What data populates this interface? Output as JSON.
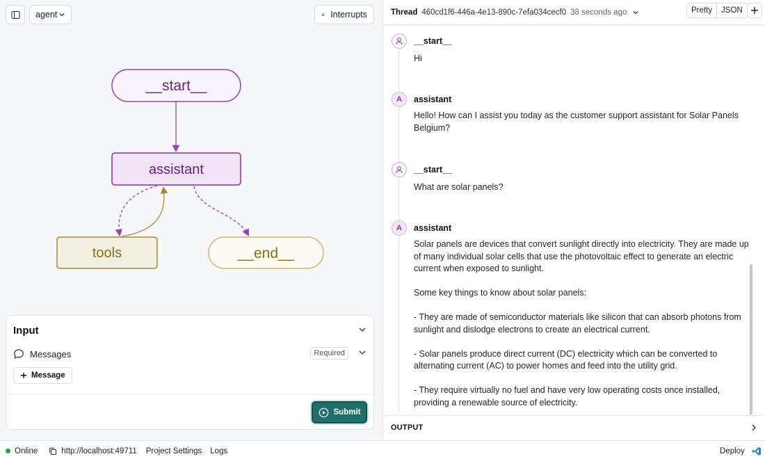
{
  "toolbar": {
    "graph_select": "agent",
    "interrupts_label": "Interrupts"
  },
  "graph": {
    "nodes": {
      "start": "__start__",
      "assistant": "assistant",
      "tools": "tools",
      "end": "__end__"
    },
    "colors": {
      "start_stroke": "#9b3fb5",
      "assistant_stroke": "#8b2fa8",
      "assistant_fill": "#f0e3f5",
      "tools_stroke": "#a78a2e",
      "tools_fill": "#f1eee2",
      "end_stroke": "#d0b86a",
      "node_text_purple": "#6b1f86",
      "node_text_gold": "#8a6d18"
    }
  },
  "input": {
    "title": "Input",
    "messages_label": "Messages",
    "required_label": "Required",
    "add_message_label": "Message",
    "submit_label": "Submit"
  },
  "thread": {
    "label": "Thread",
    "id": "460cd1f6-446a-4e13-890c-7efa034cecf0",
    "time": "38 seconds ago",
    "view_pretty": "Pretty",
    "view_json": "JSON",
    "messages": [
      {
        "avatar": "",
        "role": "__start__",
        "text": "Hi"
      },
      {
        "avatar": "A",
        "role": "assistant",
        "text": "Hello! How can I assist you today as the customer support assistant for Solar Panels Belgium?"
      },
      {
        "avatar": "",
        "role": "__start__",
        "text": "What are solar panels?"
      },
      {
        "avatar": "A",
        "role": "assistant",
        "text": "Solar panels are devices that convert sunlight directly into electricity. They are made up of many individual solar cells that use the photovoltaic effect to generate an electric current when exposed to sunlight.\n\nSome key things to know about solar panels:\n\n- They are made of semiconductor materials like silicon that can absorb photons from sunlight and dislodge electrons to create an electrical current.\n\n- Solar panels produce direct current (DC) electricity which can be converted to alternating current (AC) to power homes and feed into the utility grid.\n\n- They require virtually no fuel and have very low operating costs once installed, providing a renewable source of electricity."
      }
    ],
    "output_label": "OUTPUT"
  },
  "status": {
    "online": "Online",
    "url": "http://localhost:49711",
    "project_settings": "Project Settings",
    "logs": "Logs",
    "deploy": "Deploy"
  }
}
